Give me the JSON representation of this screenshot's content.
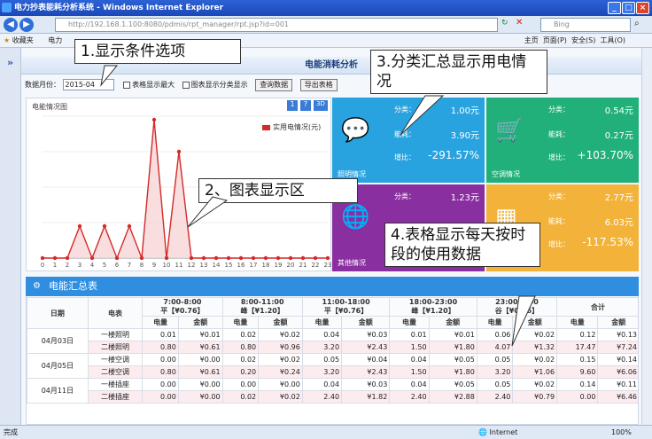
{
  "window": {
    "title": "电力抄表能耗分析系统 - Windows Internet Explorer"
  },
  "browser": {
    "url": "http://192.168.1.100:8080/pdmis/rpt_manager/rpt.jsp?id=001",
    "search_placeholder": "Bing",
    "favorites_label": "收藏夹",
    "favorites_item": "电力",
    "right_tools": [
      "主页",
      "页面(P)",
      "安全(S)",
      "工具(O)"
    ],
    "status_left": "完成",
    "status_zone": "Internet",
    "zoom": "100%"
  },
  "app": {
    "header_title": "电能消耗分析",
    "filter": {
      "month_label": "数据月份：",
      "month_value": "2015-04",
      "opt1": "表格显示最大",
      "opt2": "图表显示分类显示",
      "query_button": "查询数据",
      "export_button": "导出表格"
    },
    "chart_title": "电能情况图",
    "chart_legend": "实用电情况(元)",
    "tiles": [
      {
        "cap": "照明情况",
        "l1": "分类：",
        "v1": "1.00元",
        "l2": "能耗：",
        "v2": "3.90元",
        "l3": "增比：",
        "v3": "-291.57%",
        "color": "#29a3e0"
      },
      {
        "cap": "空调情况",
        "l1": "分类：",
        "v1": "0.54元",
        "l2": "能耗：",
        "v2": "0.27元",
        "l3": "增比：",
        "v3": "+103.70%",
        "color": "#21b07a"
      },
      {
        "cap": "其他情况",
        "l1": "分类：",
        "v1": "1.23元",
        "l2": "",
        "v2": "",
        "l3": "",
        "v3": "",
        "color": "#8a2fa0"
      },
      {
        "cap": "",
        "l1": "分类：",
        "v1": "2.77元",
        "l2": "能耗：",
        "v2": "6.03元",
        "l3": "增比：",
        "v3": "-117.53%",
        "color": "#f3b33b"
      }
    ],
    "table": {
      "title": "电能汇总表",
      "col_date": "日期",
      "col_meter": "电表",
      "periods": [
        {
          "name": "7:00-8:00",
          "price": "平【¥0.76】"
        },
        {
          "name": "8:00-11:00",
          "price": "峰【¥1.20】"
        },
        {
          "name": "11:00-18:00",
          "price": "平【¥0.76】"
        },
        {
          "name": "18:00-23:00",
          "price": "峰【¥1.20】"
        },
        {
          "name": "23:00-7:00",
          "price": "谷【¥0.36】"
        },
        {
          "name": "合计",
          "price": ""
        }
      ],
      "sub_kwh": "电量",
      "sub_amt": "金额",
      "rows": [
        {
          "date": "04月03日",
          "meter": "一楼照明",
          "c": [
            "0.01",
            "¥0.01",
            "0.02",
            "¥0.02",
            "0.04",
            "¥0.03",
            "0.01",
            "¥0.01",
            "0.06",
            "¥0.02",
            "0.12",
            "¥0.13"
          ]
        },
        {
          "date": "",
          "meter": "二楼照明",
          "c": [
            "0.80",
            "¥0.61",
            "0.80",
            "¥0.96",
            "3.20",
            "¥2.43",
            "1.50",
            "¥1.80",
            "4.07",
            "¥1.32",
            "17.47",
            "¥7.24"
          ]
        },
        {
          "date": "04月05日",
          "meter": "一楼空调",
          "c": [
            "0.00",
            "¥0.00",
            "0.02",
            "¥0.02",
            "0.05",
            "¥0.04",
            "0.04",
            "¥0.05",
            "0.05",
            "¥0.02",
            "0.15",
            "¥0.14"
          ]
        },
        {
          "date": "",
          "meter": "二楼空调",
          "c": [
            "0.80",
            "¥0.61",
            "0.20",
            "¥0.24",
            "3.20",
            "¥2.43",
            "1.50",
            "¥1.80",
            "3.20",
            "¥1.06",
            "9.60",
            "¥6.06"
          ]
        },
        {
          "date": "04月11日",
          "meter": "一楼插座",
          "c": [
            "0.00",
            "¥0.00",
            "0.00",
            "¥0.00",
            "0.04",
            "¥0.03",
            "0.04",
            "¥0.05",
            "0.05",
            "¥0.02",
            "0.14",
            "¥0.11"
          ]
        },
        {
          "date": "",
          "meter": "二楼插座",
          "c": [
            "0.00",
            "¥0.00",
            "0.02",
            "¥0.02",
            "2.40",
            "¥1.82",
            "2.40",
            "¥2.88",
            "2.40",
            "¥0.79",
            "0.00",
            "¥6.46"
          ]
        }
      ]
    }
  },
  "callouts": {
    "c1": "1.显示条件选项",
    "c2": "2、图表显示区",
    "c3": "3.分类汇总显示用电情况",
    "c4": "4.表格显示每天按时段的使用数据"
  },
  "chart_data": {
    "type": "line",
    "title": "电能情况图",
    "series": [
      {
        "name": "实用电情况(元)",
        "values": [
          0,
          0,
          0,
          0.9,
          0,
          0.9,
          0,
          0.9,
          0,
          3.9,
          0,
          3.0,
          0,
          0,
          0,
          0,
          0,
          0,
          0,
          0,
          0,
          0,
          0,
          0
        ]
      }
    ],
    "categories": [
      "0",
      "1",
      "2",
      "3",
      "4",
      "5",
      "6",
      "7",
      "8",
      "9",
      "10",
      "11",
      "12",
      "13",
      "14",
      "15",
      "16",
      "17",
      "18",
      "19",
      "20",
      "21",
      "22",
      "23"
    ],
    "ylim": [
      0,
      4
    ]
  }
}
